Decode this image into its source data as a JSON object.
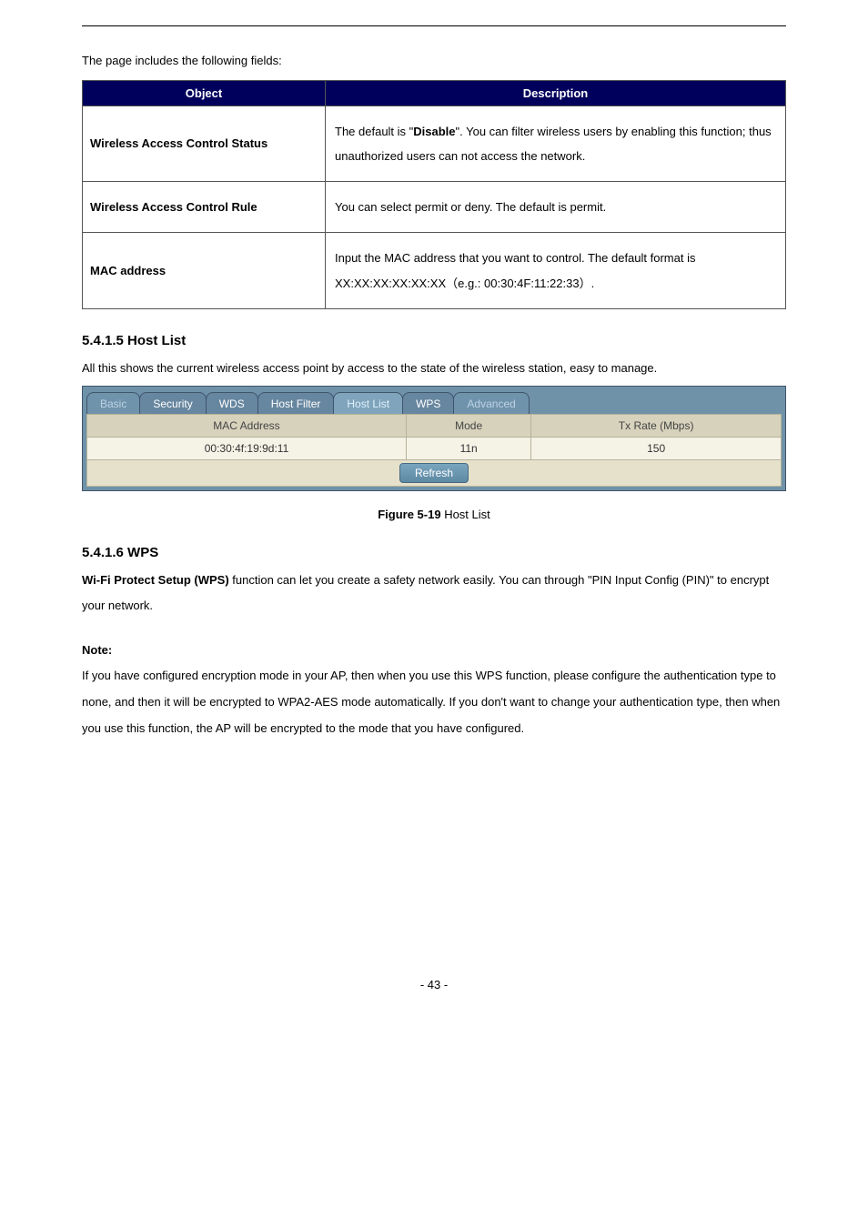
{
  "intro_text": "The page includes the following fields:",
  "def_table": {
    "headers": [
      "Object",
      "Description"
    ],
    "rows": [
      {
        "label": "Wireless Access Control Status",
        "desc_prefix": "The default is \"",
        "desc_bold": "Disable",
        "desc_suffix": "\". You can filter wireless users by enabling this function; thus unauthorized users can not access the network."
      },
      {
        "label": "Wireless Access Control Rule",
        "desc_plain": "You can select permit or deny. The default is permit."
      },
      {
        "label": "MAC address",
        "desc_plain": "Input the MAC address that you want to control. The default format is XX:XX:XX:XX:XX:XX（e.g.: 00:30:4F:11:22:33）."
      }
    ]
  },
  "section1": {
    "heading": "5.4.1.5 Host List",
    "para": "All this shows the current wireless access point by access to the state of the wireless station, easy to manage."
  },
  "tabs": {
    "items": [
      {
        "label": "Basic",
        "state": "faded"
      },
      {
        "label": "Security",
        "state": "normal"
      },
      {
        "label": "WDS",
        "state": "normal"
      },
      {
        "label": "Host Filter",
        "state": "normal"
      },
      {
        "label": "Host List",
        "state": "active"
      },
      {
        "label": "WPS",
        "state": "normal"
      },
      {
        "label": "Advanced",
        "state": "faded"
      }
    ]
  },
  "hostlist_table": {
    "headers": [
      "MAC Address",
      "Mode",
      "Tx Rate (Mbps)"
    ],
    "row": {
      "mac": "00:30:4f:19:9d:11",
      "mode": "11n",
      "rate": "150"
    },
    "refresh": "Refresh"
  },
  "figure": {
    "label": "Figure 5-19",
    "title": " Host List"
  },
  "section2": {
    "heading": "5.4.1.6 WPS",
    "para_bold": "Wi-Fi Protect Setup (WPS)",
    "para_rest": " function can let you create a safety network easily. You can through \"PIN Input Config (PIN)\" to encrypt your network.",
    "note_label": "Note:",
    "note_body": "If you have configured encryption mode in your AP, then when you use this WPS function, please configure the authentication type to none, and then it will be encrypted to WPA2-AES mode automatically. If you don't want to change your authentication type, then when you use this function, the AP will be encrypted to the mode that you have configured."
  },
  "footer": "- 43 -"
}
